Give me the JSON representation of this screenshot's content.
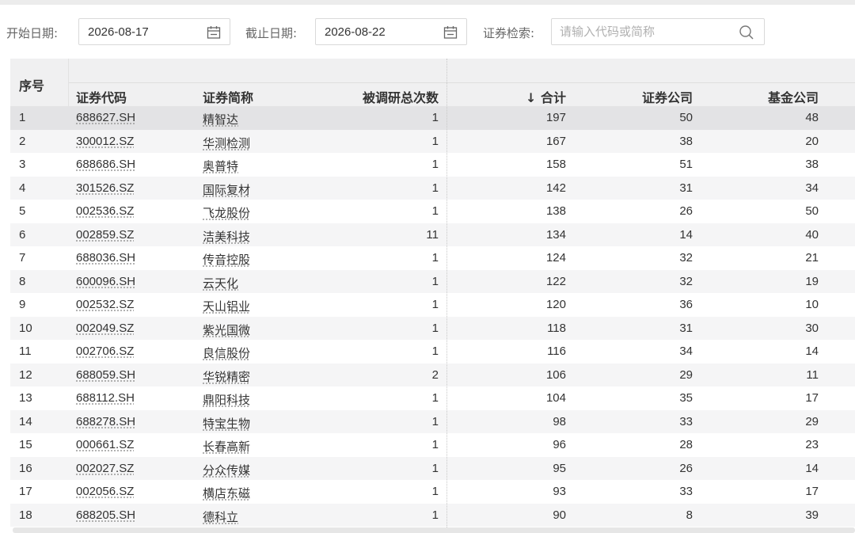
{
  "filters": {
    "start_label": "开始日期:",
    "start_value": "2026-08-17",
    "end_label": "截止日期:",
    "end_value": "2026-08-22",
    "search_label": "证券检索:",
    "search_placeholder": "请输入代码或简称"
  },
  "table": {
    "headers": {
      "index": "序号",
      "code": "证券代码",
      "name": "证券简称",
      "times": "被调研总次数",
      "total": "↓ 合计",
      "securities": "证券公司",
      "fund": "基金公司"
    },
    "rows": [
      {
        "idx": "1",
        "code": "688627.SH",
        "name": "精智达",
        "times": "1",
        "total": "197",
        "sec": "50",
        "fund": "48"
      },
      {
        "idx": "2",
        "code": "300012.SZ",
        "name": "华测检测",
        "times": "1",
        "total": "167",
        "sec": "38",
        "fund": "20"
      },
      {
        "idx": "3",
        "code": "688686.SH",
        "name": "奥普特",
        "times": "1",
        "total": "158",
        "sec": "51",
        "fund": "38"
      },
      {
        "idx": "4",
        "code": "301526.SZ",
        "name": "国际复材",
        "times": "1",
        "total": "142",
        "sec": "31",
        "fund": "34"
      },
      {
        "idx": "5",
        "code": "002536.SZ",
        "name": "飞龙股份",
        "times": "1",
        "total": "138",
        "sec": "26",
        "fund": "50"
      },
      {
        "idx": "6",
        "code": "002859.SZ",
        "name": "洁美科技",
        "times": "11",
        "total": "134",
        "sec": "14",
        "fund": "40"
      },
      {
        "idx": "7",
        "code": "688036.SH",
        "name": "传音控股",
        "times": "1",
        "total": "124",
        "sec": "32",
        "fund": "21"
      },
      {
        "idx": "8",
        "code": "600096.SH",
        "name": "云天化",
        "times": "1",
        "total": "122",
        "sec": "32",
        "fund": "19"
      },
      {
        "idx": "9",
        "code": "002532.SZ",
        "name": "天山铝业",
        "times": "1",
        "total": "120",
        "sec": "36",
        "fund": "10"
      },
      {
        "idx": "10",
        "code": "002049.SZ",
        "name": "紫光国微",
        "times": "1",
        "total": "118",
        "sec": "31",
        "fund": "30"
      },
      {
        "idx": "11",
        "code": "002706.SZ",
        "name": "良信股份",
        "times": "1",
        "total": "116",
        "sec": "34",
        "fund": "14"
      },
      {
        "idx": "12",
        "code": "688059.SH",
        "name": "华锐精密",
        "times": "2",
        "total": "106",
        "sec": "29",
        "fund": "11"
      },
      {
        "idx": "13",
        "code": "688112.SH",
        "name": "鼎阳科技",
        "times": "1",
        "total": "104",
        "sec": "35",
        "fund": "17"
      },
      {
        "idx": "14",
        "code": "688278.SH",
        "name": "特宝生物",
        "times": "1",
        "total": "98",
        "sec": "33",
        "fund": "29"
      },
      {
        "idx": "15",
        "code": "000661.SZ",
        "name": "长春高新",
        "times": "1",
        "total": "96",
        "sec": "28",
        "fund": "23"
      },
      {
        "idx": "16",
        "code": "002027.SZ",
        "name": "分众传媒",
        "times": "1",
        "total": "95",
        "sec": "26",
        "fund": "14"
      },
      {
        "idx": "17",
        "code": "002056.SZ",
        "name": "横店东磁",
        "times": "1",
        "total": "93",
        "sec": "33",
        "fund": "17"
      },
      {
        "idx": "18",
        "code": "688205.SH",
        "name": "德科立",
        "times": "1",
        "total": "90",
        "sec": "8",
        "fund": "39"
      }
    ]
  },
  "icons": {
    "date": "calendar-icon",
    "search": "search-icon"
  },
  "colors": {
    "header_bg": "#f0f0f1",
    "row_alt": "#f5f5f6",
    "row_selected": "#e3e3e5",
    "border": "#d9d9d9"
  }
}
